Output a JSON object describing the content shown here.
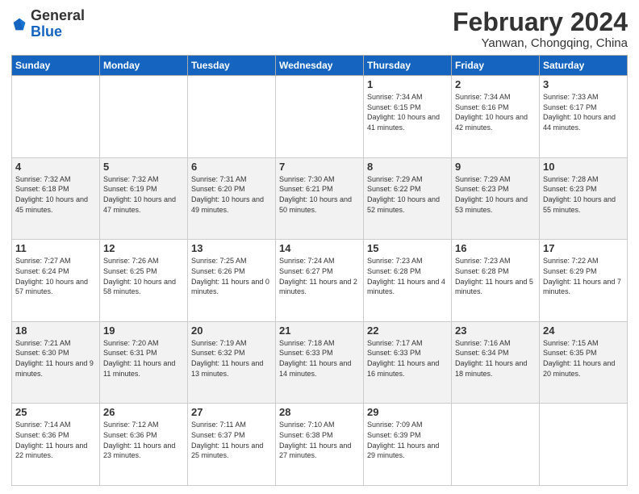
{
  "header": {
    "logo": {
      "general": "General",
      "blue": "Blue"
    },
    "title": "February 2024",
    "subtitle": "Yanwan, Chongqing, China"
  },
  "calendar": {
    "days_of_week": [
      "Sunday",
      "Monday",
      "Tuesday",
      "Wednesday",
      "Thursday",
      "Friday",
      "Saturday"
    ],
    "weeks": [
      [
        {
          "day": "",
          "detail": ""
        },
        {
          "day": "",
          "detail": ""
        },
        {
          "day": "",
          "detail": ""
        },
        {
          "day": "",
          "detail": ""
        },
        {
          "day": "1",
          "detail": "Sunrise: 7:34 AM\nSunset: 6:15 PM\nDaylight: 10 hours\nand 41 minutes."
        },
        {
          "day": "2",
          "detail": "Sunrise: 7:34 AM\nSunset: 6:16 PM\nDaylight: 10 hours\nand 42 minutes."
        },
        {
          "day": "3",
          "detail": "Sunrise: 7:33 AM\nSunset: 6:17 PM\nDaylight: 10 hours\nand 44 minutes."
        }
      ],
      [
        {
          "day": "4",
          "detail": "Sunrise: 7:32 AM\nSunset: 6:18 PM\nDaylight: 10 hours\nand 45 minutes."
        },
        {
          "day": "5",
          "detail": "Sunrise: 7:32 AM\nSunset: 6:19 PM\nDaylight: 10 hours\nand 47 minutes."
        },
        {
          "day": "6",
          "detail": "Sunrise: 7:31 AM\nSunset: 6:20 PM\nDaylight: 10 hours\nand 49 minutes."
        },
        {
          "day": "7",
          "detail": "Sunrise: 7:30 AM\nSunset: 6:21 PM\nDaylight: 10 hours\nand 50 minutes."
        },
        {
          "day": "8",
          "detail": "Sunrise: 7:29 AM\nSunset: 6:22 PM\nDaylight: 10 hours\nand 52 minutes."
        },
        {
          "day": "9",
          "detail": "Sunrise: 7:29 AM\nSunset: 6:23 PM\nDaylight: 10 hours\nand 53 minutes."
        },
        {
          "day": "10",
          "detail": "Sunrise: 7:28 AM\nSunset: 6:23 PM\nDaylight: 10 hours\nand 55 minutes."
        }
      ],
      [
        {
          "day": "11",
          "detail": "Sunrise: 7:27 AM\nSunset: 6:24 PM\nDaylight: 10 hours\nand 57 minutes."
        },
        {
          "day": "12",
          "detail": "Sunrise: 7:26 AM\nSunset: 6:25 PM\nDaylight: 10 hours\nand 58 minutes."
        },
        {
          "day": "13",
          "detail": "Sunrise: 7:25 AM\nSunset: 6:26 PM\nDaylight: 11 hours\nand 0 minutes."
        },
        {
          "day": "14",
          "detail": "Sunrise: 7:24 AM\nSunset: 6:27 PM\nDaylight: 11 hours\nand 2 minutes."
        },
        {
          "day": "15",
          "detail": "Sunrise: 7:23 AM\nSunset: 6:28 PM\nDaylight: 11 hours\nand 4 minutes."
        },
        {
          "day": "16",
          "detail": "Sunrise: 7:23 AM\nSunset: 6:28 PM\nDaylight: 11 hours\nand 5 minutes."
        },
        {
          "day": "17",
          "detail": "Sunrise: 7:22 AM\nSunset: 6:29 PM\nDaylight: 11 hours\nand 7 minutes."
        }
      ],
      [
        {
          "day": "18",
          "detail": "Sunrise: 7:21 AM\nSunset: 6:30 PM\nDaylight: 11 hours\nand 9 minutes."
        },
        {
          "day": "19",
          "detail": "Sunrise: 7:20 AM\nSunset: 6:31 PM\nDaylight: 11 hours\nand 11 minutes."
        },
        {
          "day": "20",
          "detail": "Sunrise: 7:19 AM\nSunset: 6:32 PM\nDaylight: 11 hours\nand 13 minutes."
        },
        {
          "day": "21",
          "detail": "Sunrise: 7:18 AM\nSunset: 6:33 PM\nDaylight: 11 hours\nand 14 minutes."
        },
        {
          "day": "22",
          "detail": "Sunrise: 7:17 AM\nSunset: 6:33 PM\nDaylight: 11 hours\nand 16 minutes."
        },
        {
          "day": "23",
          "detail": "Sunrise: 7:16 AM\nSunset: 6:34 PM\nDaylight: 11 hours\nand 18 minutes."
        },
        {
          "day": "24",
          "detail": "Sunrise: 7:15 AM\nSunset: 6:35 PM\nDaylight: 11 hours\nand 20 minutes."
        }
      ],
      [
        {
          "day": "25",
          "detail": "Sunrise: 7:14 AM\nSunset: 6:36 PM\nDaylight: 11 hours\nand 22 minutes."
        },
        {
          "day": "26",
          "detail": "Sunrise: 7:12 AM\nSunset: 6:36 PM\nDaylight: 11 hours\nand 23 minutes."
        },
        {
          "day": "27",
          "detail": "Sunrise: 7:11 AM\nSunset: 6:37 PM\nDaylight: 11 hours\nand 25 minutes."
        },
        {
          "day": "28",
          "detail": "Sunrise: 7:10 AM\nSunset: 6:38 PM\nDaylight: 11 hours\nand 27 minutes."
        },
        {
          "day": "29",
          "detail": "Sunrise: 7:09 AM\nSunset: 6:39 PM\nDaylight: 11 hours\nand 29 minutes."
        },
        {
          "day": "",
          "detail": ""
        },
        {
          "day": "",
          "detail": ""
        }
      ]
    ]
  }
}
